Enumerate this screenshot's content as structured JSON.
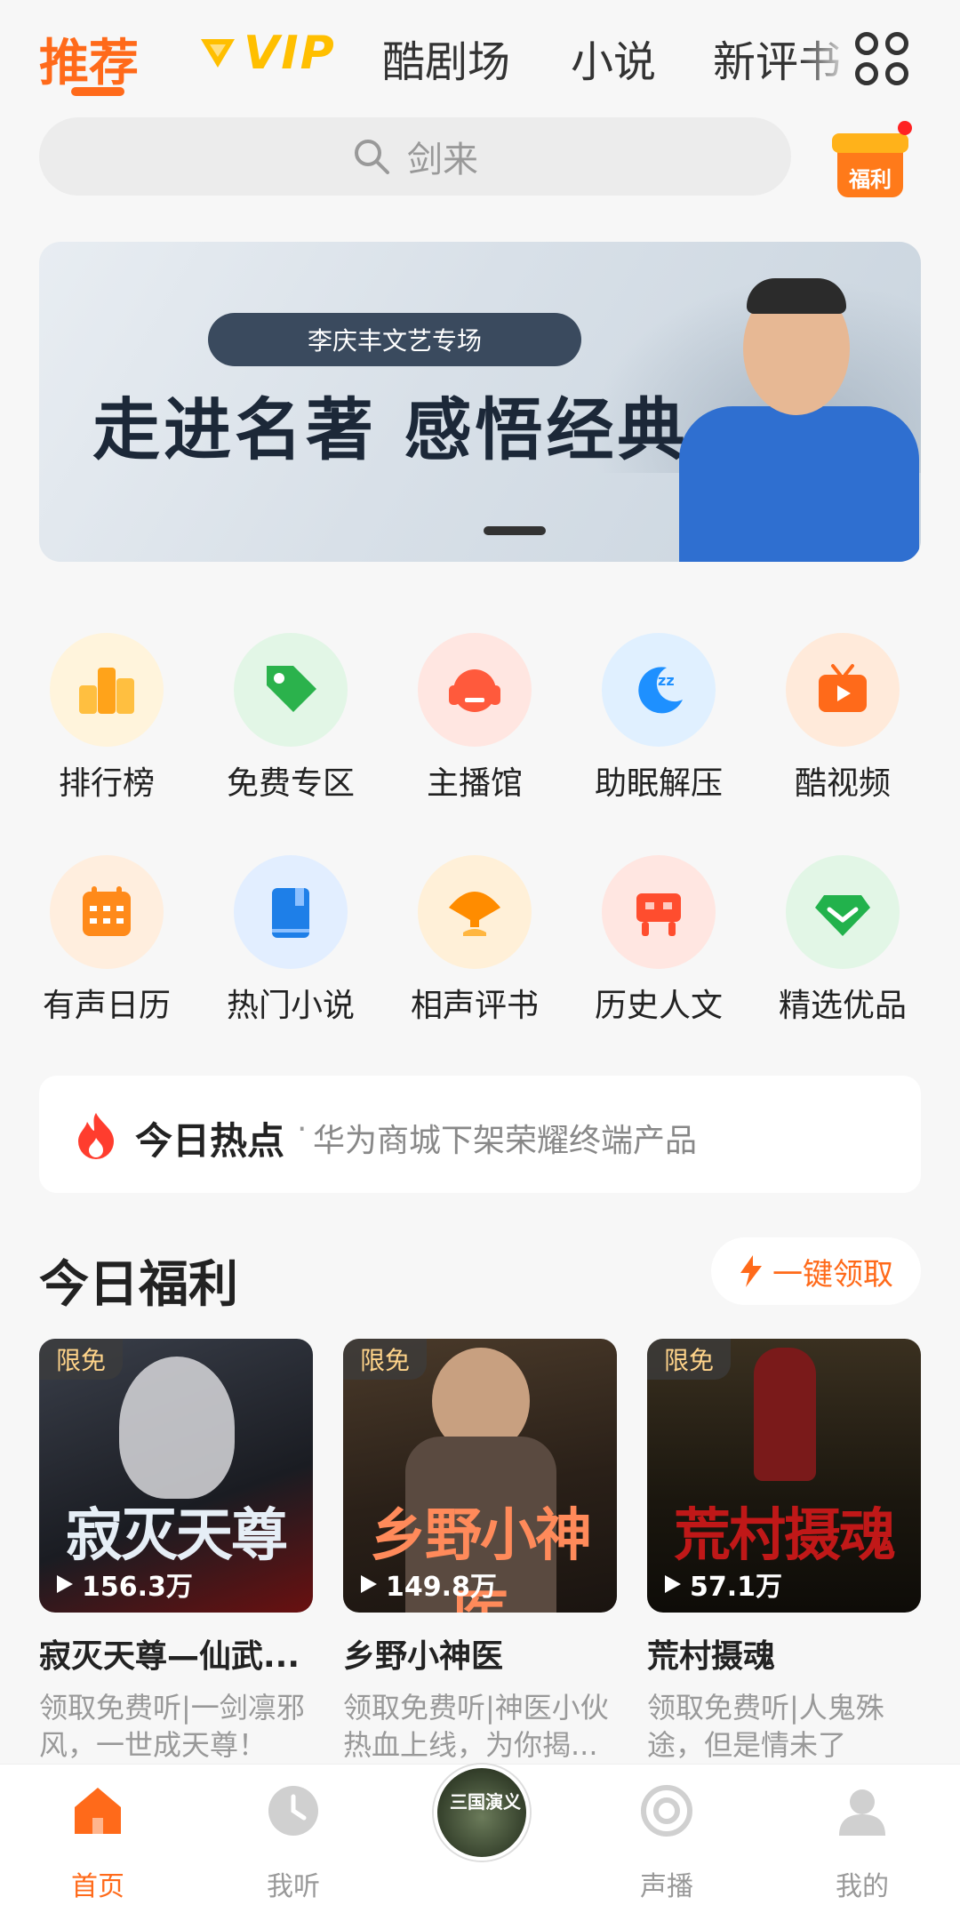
{
  "tabs": {
    "recommend": "推荐",
    "vip": "VIP",
    "theater": "酷剧场",
    "novel": "小说",
    "pingshu": "新评书"
  },
  "search": {
    "placeholder": "剑来"
  },
  "gift": {
    "label": "福利"
  },
  "banner": {
    "tag": "李庆丰文艺专场",
    "title": "走进名著 感悟经典"
  },
  "grid": [
    {
      "label": "排行榜",
      "icon": "ranking-icon",
      "color": "#ffa31a"
    },
    {
      "label": "免费专区",
      "icon": "tag-icon",
      "color": "#2bb24c"
    },
    {
      "label": "主播馆",
      "icon": "headphones-icon",
      "color": "#ff5a3c"
    },
    {
      "label": "助眠解压",
      "icon": "moon-icon",
      "color": "#1e90ff"
    },
    {
      "label": "酷视频",
      "icon": "tv-icon",
      "color": "#ff6a1a"
    },
    {
      "label": "有声日历",
      "icon": "calendar-icon",
      "color": "#ff8a1a"
    },
    {
      "label": "热门小说",
      "icon": "book-icon",
      "color": "#1e7fe8"
    },
    {
      "label": "相声评书",
      "icon": "fan-icon",
      "color": "#ff8c00"
    },
    {
      "label": "历史人文",
      "icon": "ding-icon",
      "color": "#ff4d2e"
    },
    {
      "label": "精选优品",
      "icon": "diamond-icon",
      "color": "#22b24c"
    }
  ],
  "hot": {
    "title": "今日热点",
    "dot": "·",
    "text": "华为商城下架荣耀终端产品"
  },
  "welfare": {
    "title": "今日福利",
    "button": "一键领取"
  },
  "cards": [
    {
      "badge": "限免",
      "plays": "156.3万",
      "cover_title": "寂灭天尊",
      "name": "寂灭天尊—仙武...",
      "desc": "领取免费听|一剑凛邪风，一世成天尊！"
    },
    {
      "badge": "限免",
      "plays": "149.8万",
      "cover_title": "乡野小神医",
      "name": "乡野小神医",
      "desc": "领取免费听|神医小伙热血上线，为你揭..."
    },
    {
      "badge": "限免",
      "plays": "57.1万",
      "cover_title": "荒村摄魂",
      "name": "荒村摄魂",
      "desc": "领取免费听|人鬼殊途，但是情未了"
    }
  ],
  "bottom_nav": {
    "home": "首页",
    "listen": "我听",
    "center": "三国演义",
    "broadcast": "声播",
    "mine": "我的"
  },
  "colors": {
    "accent": "#ff6a1a",
    "vip": "#ffbf00"
  }
}
